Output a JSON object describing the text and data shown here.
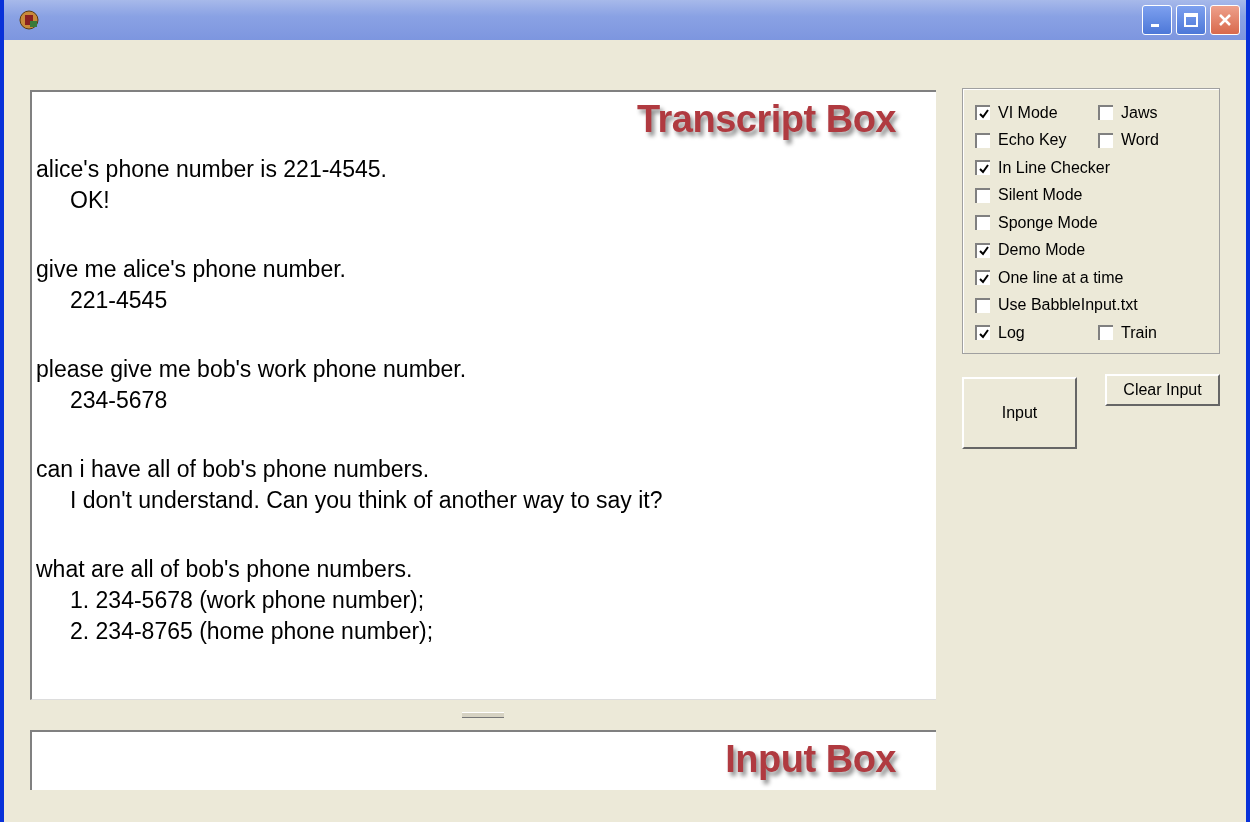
{
  "transcript": {
    "label": "Transcript Box",
    "exchanges": [
      {
        "prompt": "alice's phone number is 221-4545.",
        "replies": [
          "OK!"
        ]
      },
      {
        "prompt": "give me alice's phone number.",
        "replies": [
          "221-4545"
        ]
      },
      {
        "prompt": "please give me bob's work phone number.",
        "replies": [
          "234-5678"
        ]
      },
      {
        "prompt": "can i have all of bob's phone numbers.",
        "replies": [
          "I don't understand. Can you think of another way to say it?"
        ]
      },
      {
        "prompt": "what are all of bob's phone numbers.",
        "replies": [
          "1. 234-5678 (work phone number);",
          "2. 234-8765 (home phone number);"
        ]
      }
    ]
  },
  "input_box": {
    "label": "Input Box"
  },
  "options": [
    {
      "items": [
        {
          "label": "VI Mode",
          "checked": true
        },
        {
          "label": "Jaws",
          "checked": false
        }
      ]
    },
    {
      "items": [
        {
          "label": "Echo Key",
          "checked": false
        },
        {
          "label": "Word",
          "checked": false
        }
      ]
    },
    {
      "items": [
        {
          "label": "In Line Checker",
          "checked": true
        }
      ]
    },
    {
      "items": [
        {
          "label": "Silent Mode",
          "checked": false
        }
      ]
    },
    {
      "items": [
        {
          "label": "Sponge Mode",
          "checked": false
        }
      ]
    },
    {
      "items": [
        {
          "label": "Demo Mode",
          "checked": true
        }
      ]
    },
    {
      "items": [
        {
          "label": "One line at a time",
          "checked": true
        }
      ]
    },
    {
      "items": [
        {
          "label": "Use BabbleInput.txt",
          "checked": false
        }
      ]
    },
    {
      "items": [
        {
          "label": "Log",
          "checked": true
        },
        {
          "label": "Train",
          "checked": false
        }
      ]
    }
  ],
  "buttons": {
    "input": "Input",
    "clear": "Clear Input"
  }
}
